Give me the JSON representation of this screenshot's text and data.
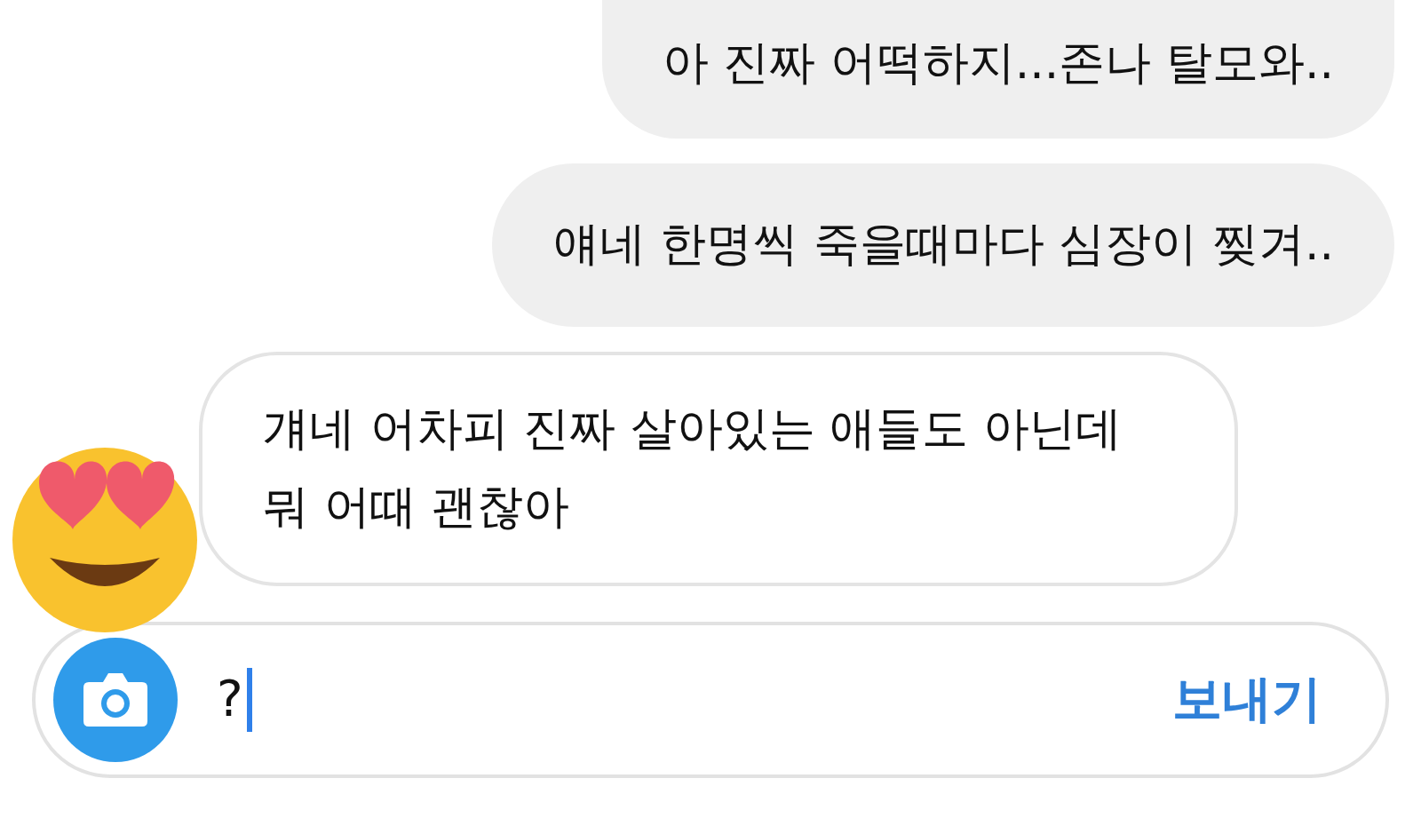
{
  "messages": [
    {
      "kind": "sent",
      "text": "아 진짜 어떡하지...존나 탈모와.."
    },
    {
      "kind": "sent",
      "text": "얘네 한명씩 죽을때마다 심장이 찢겨.."
    },
    {
      "kind": "received",
      "text": "걔네 어차피 진짜 살아있는 애들도 아닌데 뭐 어때 괜찮아"
    }
  ],
  "composer": {
    "value": "?",
    "send_label": "보내기"
  }
}
